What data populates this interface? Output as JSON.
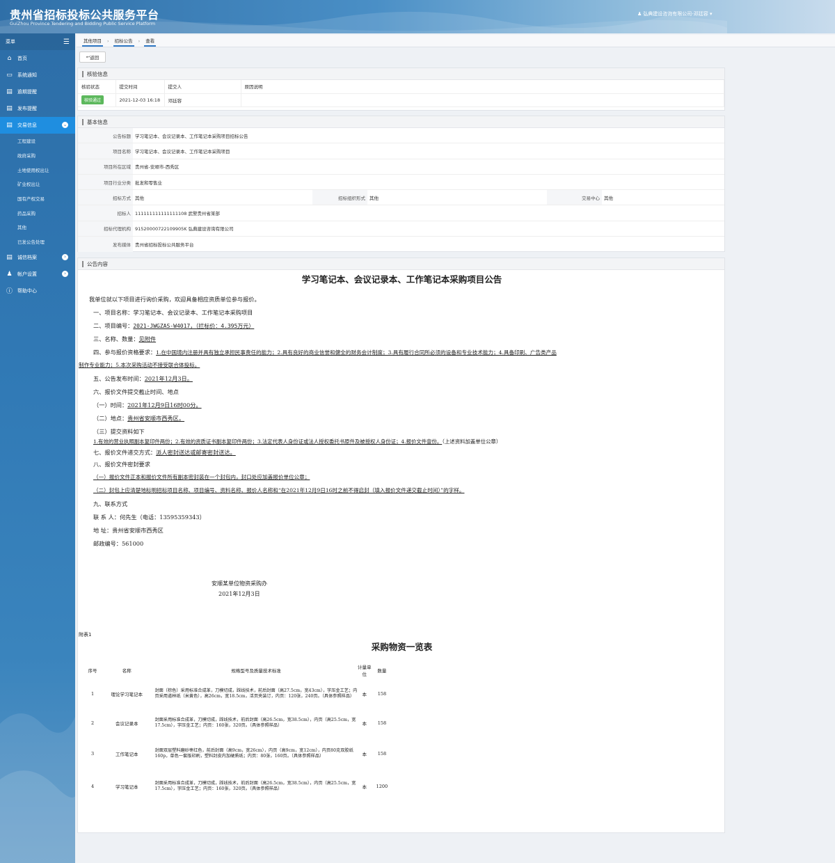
{
  "header": {
    "title": "贵州省招标投标公共服务平台",
    "subtitle": "GuiZhou Province Tendering and Bidding Public Service Platform",
    "user": "弘典建设咨询有限公司-邓廷容"
  },
  "sidebar": {
    "menu_label": "菜单",
    "items": [
      {
        "label": "首页",
        "icon": "home-icon"
      },
      {
        "label": "系统通知",
        "icon": "monitor-icon"
      },
      {
        "label": "逾期提醒",
        "icon": "list-icon"
      },
      {
        "label": "发布提醒",
        "icon": "list-icon"
      },
      {
        "label": "交易信息",
        "icon": "list-icon",
        "active": true
      },
      {
        "label": "诚信档案",
        "icon": "list-icon"
      },
      {
        "label": "帐户设置",
        "icon": "user-icon"
      },
      {
        "label": "帮助中心",
        "icon": "help-icon"
      }
    ],
    "sub_items": [
      "工程建设",
      "政府采购",
      "土地使用权出让",
      "矿业权出让",
      "国有产权交易",
      "药品采购",
      "其他",
      "已发公告处理"
    ]
  },
  "breadcrumb": [
    "其他项目",
    "招标公告",
    "查看"
  ],
  "back_label": "返回",
  "verify": {
    "title": "核验信息",
    "headers": [
      "核验状态",
      "提交时间",
      "提交人",
      "原因说明"
    ],
    "status": "核验通过",
    "time": "2021-12-03 16:18",
    "submitter": "邓廷容",
    "reason": ""
  },
  "basic": {
    "title": "基本信息",
    "rows": [
      {
        "label": "公告标题",
        "value": "学习笔记本、会议记录本、工作笔记本采购项目招标公告"
      },
      {
        "label": "项目名称",
        "value": "学习笔记本、会议记录本、工作笔记本采购项目"
      },
      {
        "label": "项目所在区域",
        "value": "贵州省-安顺市-西秀区"
      },
      {
        "label": "项目行业分类",
        "value": "批发和零售业"
      },
      {
        "label": "招标方式",
        "value": "其他",
        "label2": "招标组织形式",
        "value2": "其他",
        "label3": "交易中心",
        "value3": "其他"
      },
      {
        "label": "招标人",
        "value": "111111111111111108 武警贵州省某部"
      },
      {
        "label": "招标代理机构",
        "value": "91520000722109905K 弘典建设咨询有限公司"
      },
      {
        "label": "发布媒体",
        "value": "贵州省招标投标公共服务平台"
      }
    ]
  },
  "notice": {
    "title": "公告内容",
    "doc_title": "学习笔记本、会议记录本、工作笔记本采购项目公告",
    "intro": "我单位就以下项目进行询价采购，欢迎具备相应资质单位参与报价。",
    "l1": "一、项目名称：学习笔记本、会议记录本、工作笔记本采购项目",
    "l2a": "二、项目编号：",
    "l2b": "2021-JWGZAS-W4017，（拦标价：4.395万元）",
    "l3a": "三、名称、数量：",
    "l3b": "见附件",
    "l4a": "四、参与报价资格要求：",
    "l4b": "1.在中国境内注册并具有独立承担民事责任的能力；2.具有良好的商业信誉和健全的财务会计制度；3.具有履行合同所必须的设备和专业技术能力；4.具备印刷、广告类产品",
    "l4c": "制作专业能力；5.本次采购活动不接受联合体投标。",
    "l5a": "五、公告发布时间：",
    "l5b": "2021年12月3日。",
    "l6": "六、报价文件提交截止时间、地点",
    "l6a": "（一）时间：",
    "l6b": "2021年12月9日16时00分。",
    "l6c": "（二）地点：",
    "l6d": "贵州省安顺市西秀区。",
    "l6e": "（三）提交资料如下",
    "l6f": "1.有效的营业执照副本复印件两份；2.有效的资质证书副本复印件两份；3.法定代表人身份证或法人授权委托书原件及被授权人身份证；4.报价文件壹份。",
    "l6g": "（上述资料加盖单位公章）",
    "l7a": "七、报价文件递交方式：",
    "l7b": "派人密封送达或邮寄密封送达。",
    "l8": "八、报价文件密封要求",
    "l8a": "（一）报价文件正本和报价文件所有副本密封装在一个封包内，封口处应加盖报价单位公章；",
    "l8b": "（二）封包上应清楚地标明招标项目名称、项目编号、资料名称、报价人名称和“在2021年12月9日16时之前不得启封（填入报价文件递交截止时间）”的字样。",
    "l9": "九、联系方式",
    "c1": "联 系 人：何先生（电话：13595359343）",
    "c2": "地    址：贵州省安顺市西秀区",
    "c3": "邮政编号：561000",
    "sig1": "安顺某单位物资采购办",
    "sig2": "2021年12月3日",
    "attach": "附表1",
    "list_title": "采购物资一览表",
    "table": {
      "headers": [
        "序号",
        "名称",
        "规格型号及质量技术标准",
        "计量单位",
        "数量"
      ],
      "rows": [
        [
          "1",
          "理论学习笔记本",
          "封面（棕色）采用标准合成革，刀模切成，踩线技术，前后封面（高27.5cm，宽43cm），字压金工艺；内页采用道林纸（米黄色），高26cm，宽18.5cm，活页夹装订，内页：120张，240页。（具体参照样品）",
          "本",
          "158"
        ],
        [
          "2",
          "会议记录本",
          "封面采用标准合成革，刀模切成，踩线技术，前后封面（高26.5cm，宽38.5cm），内页（高25.5cm，宽17.5cm），字压金工艺；内页：160张，320页。（具体参照样品）",
          "本",
          "158"
        ],
        [
          "3",
          "工作笔记本",
          "封面双层塑料磨砂枣红色，前后封面（高9cm，宽26cm），内页（高9cm，宽12cm），内页80克双胶纸160p，单色一套版印刷，塑料封皮内加硬质纸；内页：80张，160页。（具体参照样品）",
          "本",
          "158"
        ],
        [
          "4",
          "学习笔记本",
          "封面采用标准合成革，刀模切成，踩线技术，前后封面（高26.5cm，宽38.5cm），内页（高25.5cm，宽17.5cm），字压金工艺；内页：160张，320页。（具体参照样品）",
          "本",
          "1200"
        ]
      ]
    }
  }
}
